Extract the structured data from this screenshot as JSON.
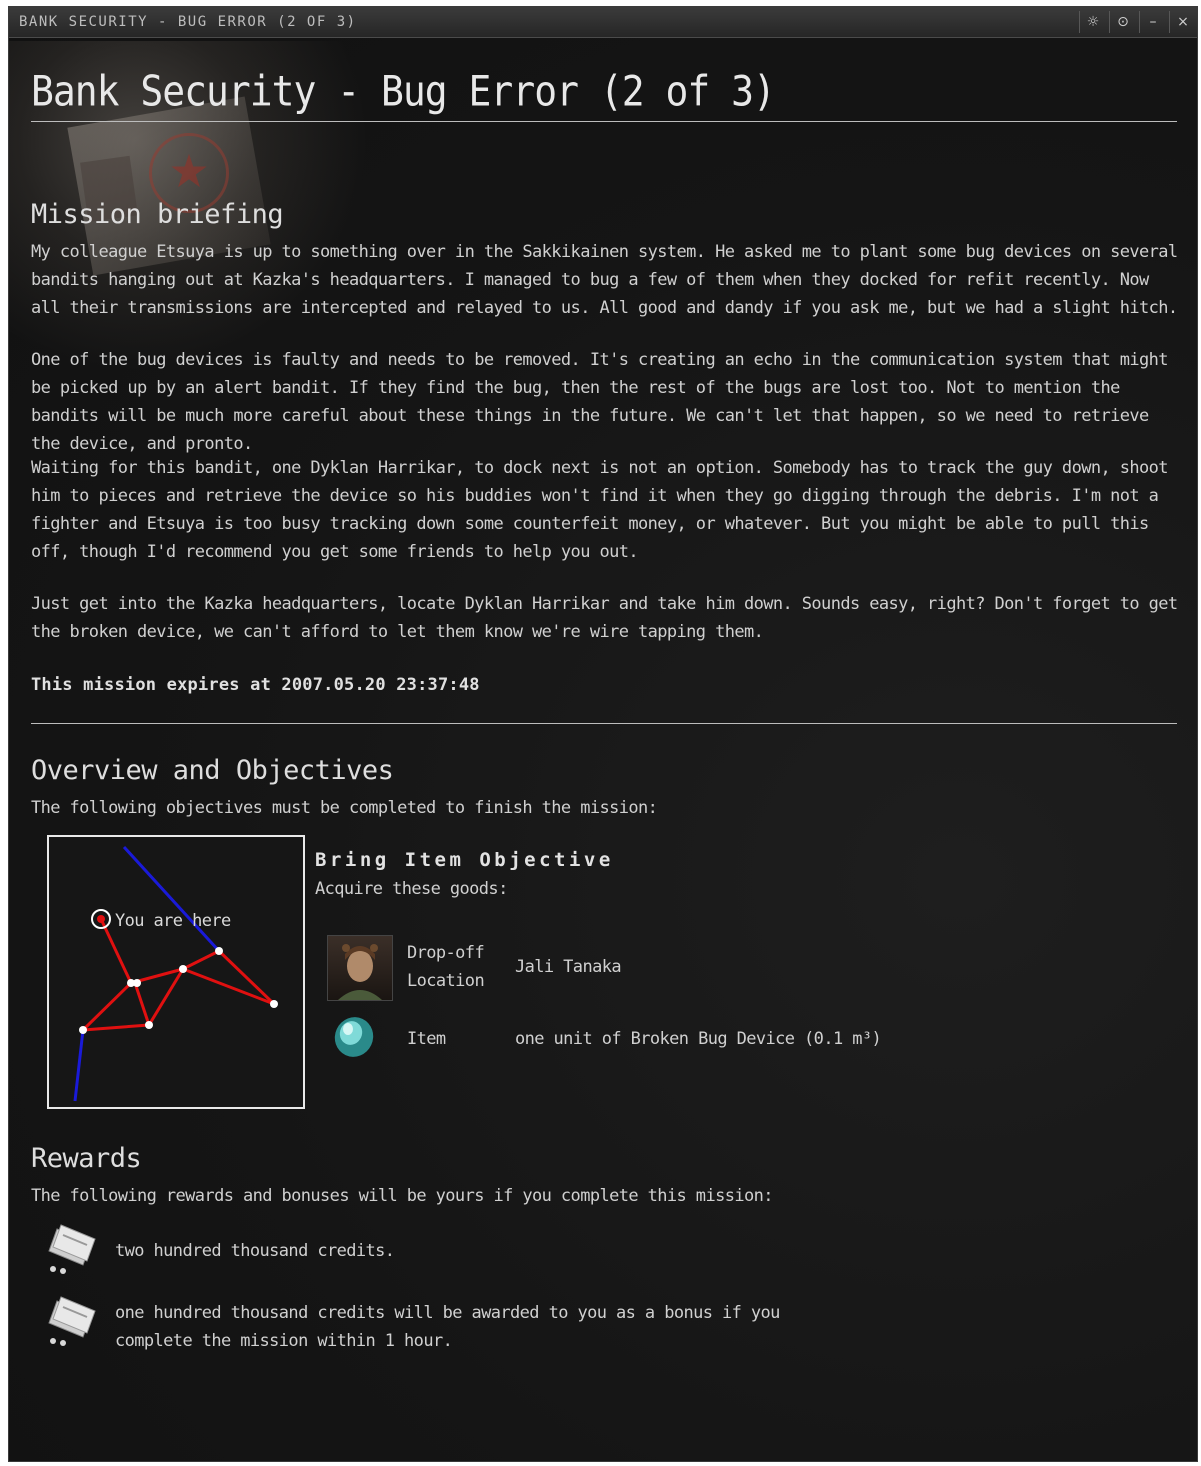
{
  "window": {
    "caption": "BANK SECURITY - BUG ERROR (2 OF 3)",
    "buttons": {
      "settings": "☼",
      "pin": "⊙",
      "minimize": "–",
      "close": "×"
    }
  },
  "header": {
    "title": "Bank Security - Bug Error (2 of 3)"
  },
  "briefing": {
    "heading": "Mission briefing",
    "paragraphs": [
      "My colleague Etsuya is up to something over in the Sakkikainen system. He asked me to plant some bug devices on several bandits hanging out at Kazka's headquarters. I managed to bug a few of them when they docked for refit recently. Now all their transmissions are intercepted and relayed to us. All good and dandy if you ask me, but we had a slight hitch.",
      "One of the bug devices is faulty and needs to be removed. It's creating an echo in the communication system that might be picked up by an alert bandit. If they find the bug, then the rest of the bugs are lost too. Not to mention the bandits will be much more careful about these things in the future. We can't let that happen, so we need to retrieve the device, and pronto.",
      "Waiting for this bandit, one Dyklan Harrikar, to dock next is not an option. Somebody has to track the guy down, shoot him to pieces and retrieve the device so his buddies won't find it when they go digging through the debris. I'm not a fighter and Etsuya is too busy tracking down some counterfeit money, or whatever. But you might be able to pull this off, though I'd recommend you get some friends to help you out.",
      "Just get into the Kazka headquarters, locate Dyklan Harrikar and take him down. Sounds easy, right? Don't forget to get the broken device, we can't afford to let them know we're wire tapping them."
    ],
    "expires": "This mission expires at 2007.05.20 23:37:48"
  },
  "overview": {
    "heading": "Overview and Objectives",
    "intro": "The following objectives must be completed to finish the mission:",
    "map": {
      "marker_label": "You are here"
    },
    "objective": {
      "title": "Bring Item Objective",
      "subtitle": "Acquire these goods:",
      "rows": [
        {
          "label_line1": "Drop-off",
          "label_line2": "Location",
          "value": "Jali Tanaka",
          "icon": "agent-portrait-icon"
        },
        {
          "label": "Item",
          "value": "one unit of Broken Bug Device (0.1 m³)",
          "icon": "bug-device-icon"
        }
      ]
    }
  },
  "rewards": {
    "heading": "Rewards",
    "intro": "The following rewards and bonuses will be yours if you complete this mission:",
    "items": [
      {
        "line1": "two hundred thousand credits.",
        "icon": "isk-credits-icon"
      },
      {
        "line1": "one hundred thousand credits will be awarded to you as a bonus if you",
        "line2": "complete the mission within 1 hour.",
        "icon": "isk-credits-icon"
      }
    ]
  },
  "colors": {
    "route": "#e01010",
    "route_out": "#1010d8",
    "background": "#151515"
  }
}
